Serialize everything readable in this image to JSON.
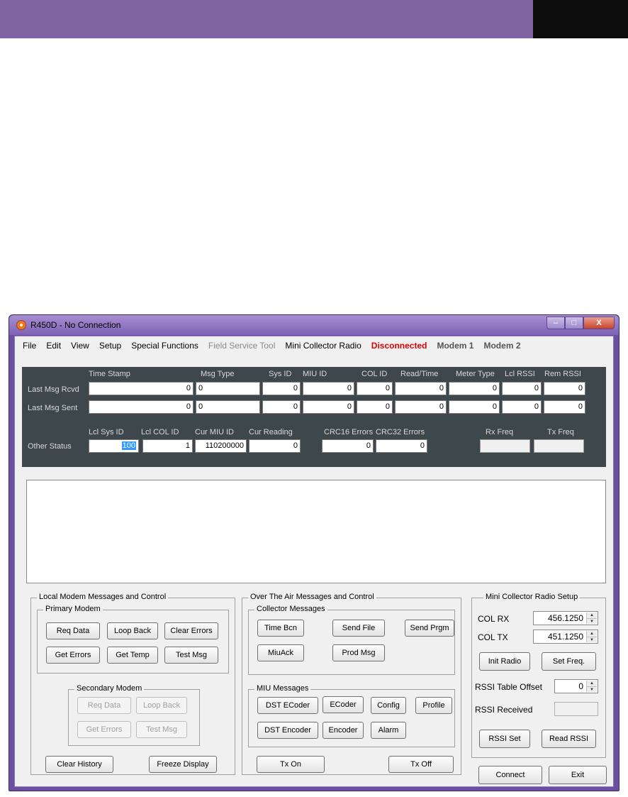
{
  "window": {
    "title": "R450D - No Connection",
    "controls": {
      "minimize": "–",
      "maximize": "□",
      "close": "X"
    }
  },
  "menu": {
    "file": "File",
    "edit": "Edit",
    "view": "View",
    "setup": "Setup",
    "special": "Special Functions",
    "field_service": "Field Service Tool",
    "mini_collector": "Mini Collector Radio",
    "status": "Disconnected",
    "modem1": "Modem 1",
    "modem2": "Modem 2"
  },
  "status_panel": {
    "headers": {
      "time_stamp": "Time Stamp",
      "msg_type": "Msg Type",
      "sys_id": "Sys ID",
      "miu_id": "MIU ID",
      "col_id": "COL ID",
      "read_time": "Read/Time",
      "meter_type": "Meter Type",
      "lcl_rssi": "Lcl RSSI",
      "rem_rssi": "Rem RSSI"
    },
    "rows": {
      "rcvd": {
        "label": "Last Msg Rcvd",
        "time_stamp": "0",
        "msg_type": "0",
        "sys_id": "0",
        "miu_id": "0",
        "col_id": "0",
        "read_time": "0",
        "meter_type": "0",
        "lcl_rssi": "0",
        "rem_rssi": "0"
      },
      "sent": {
        "label": "Last Msg Sent",
        "time_stamp": "0",
        "msg_type": "0",
        "sys_id": "0",
        "miu_id": "0",
        "col_id": "0",
        "read_time": "0",
        "meter_type": "0",
        "lcl_rssi": "0",
        "rem_rssi": "0"
      }
    },
    "other": {
      "label": "Other Status",
      "headers": {
        "lcl_sys_id": "Lcl Sys ID",
        "lcl_col_id": "Lcl COL ID",
        "cur_miu_id": "Cur MIU ID",
        "cur_reading": "Cur Reading",
        "crc16": "CRC16 Errors",
        "crc32": "CRC32 Errors",
        "rx_freq": "Rx Freq",
        "tx_freq": "Tx Freq"
      },
      "lcl_sys_id": "100",
      "lcl_col_id": "1",
      "cur_miu_id": "110200000",
      "cur_reading": "0",
      "crc16": "0",
      "crc32": "0"
    }
  },
  "local_modem": {
    "title": "Local Modem Messages and Control",
    "primary": {
      "title": "Primary Modem",
      "req_data": "Req Data",
      "loop_back": "Loop Back",
      "clear_errors": "Clear Errors",
      "get_errors": "Get Errors",
      "get_temp": "Get Temp",
      "test_msg": "Test Msg"
    },
    "secondary": {
      "title": "Secondary Modem",
      "req_data": "Req Data",
      "loop_back": "Loop Back",
      "get_errors": "Get Errors",
      "test_msg": "Test Msg"
    },
    "clear_history": "Clear History",
    "freeze_display": "Freeze Display"
  },
  "ota": {
    "title": "Over The Air Messages and Control",
    "collector": {
      "title": "Collector Messages",
      "time_bcn": "Time Bcn",
      "send_file": "Send File",
      "send_prgm": "Send Prgm",
      "miu_ack": "MiuAck",
      "prod_msg": "Prod Msg"
    },
    "miu": {
      "title": "MIU Messages",
      "dst_ecoder": "DST ECoder",
      "ecoder": "ECoder",
      "config": "Config",
      "profile": "Profile",
      "dst_encoder": "DST Encoder",
      "encoder": "Encoder",
      "alarm": "Alarm"
    },
    "tx_on": "Tx On",
    "tx_off": "Tx Off"
  },
  "radio_setup": {
    "title": "Mini Collector Radio Setup",
    "col_rx_label": "COL RX",
    "col_rx": "456.1250",
    "col_tx_label": "COL TX",
    "col_tx": "451.1250",
    "init_radio": "Init Radio",
    "set_freq": "Set Freq.",
    "rssi_offset_label": "RSSI Table Offset",
    "rssi_offset": "0",
    "rssi_received_label": "RSSI Received",
    "rssi_set": "RSSI Set",
    "read_rssi": "Read RSSI"
  },
  "footer": {
    "connect": "Connect",
    "exit": "Exit"
  }
}
